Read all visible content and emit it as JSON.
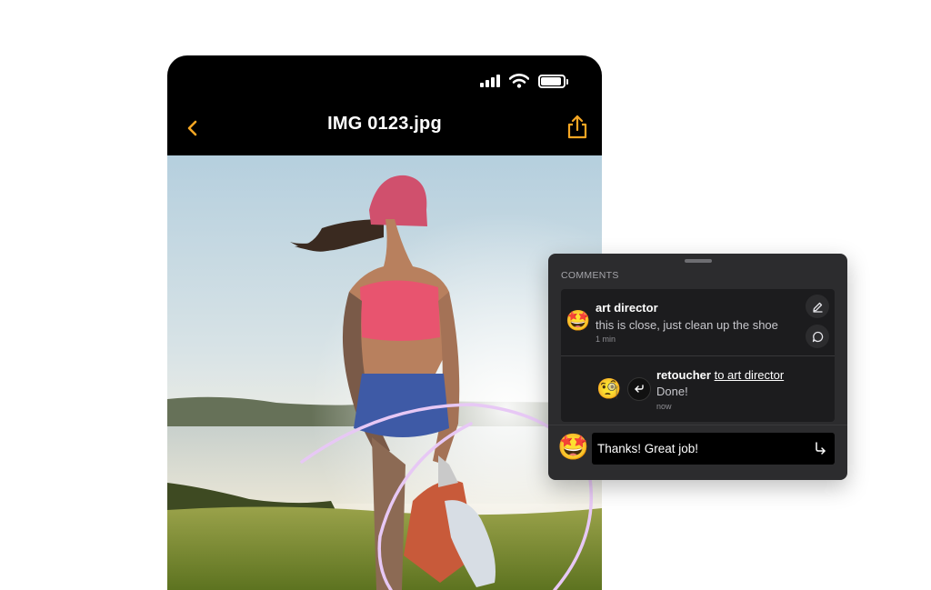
{
  "phone": {
    "status": {
      "signal_icon": "cellular-signal-icon",
      "wifi_icon": "wifi-icon",
      "battery_icon": "battery-icon",
      "battery_level": 0.9
    },
    "nav": {
      "title": "IMG 0123.jpg",
      "back_icon": "chevron-left-icon",
      "share_icon": "share-icon",
      "accent": "#f5a623"
    },
    "photo": {
      "subject": "athlete-stretching-photo"
    }
  },
  "comments": {
    "header": "COMMENTS",
    "thread": [
      {
        "author": "art director",
        "avatar_icon": "star-struck-emoji-icon",
        "text": "this is close, just clean up the shoe",
        "time": "1 min"
      },
      {
        "author": "retoucher",
        "mention": "to art director",
        "avatar_icon": "monocle-face-emoji-icon",
        "text": "Done!",
        "time": "now"
      }
    ],
    "actions": {
      "edit_icon": "edit-icon",
      "reply_icon": "reply-bubble-icon"
    },
    "composer": {
      "value": "Thanks! Great job!",
      "avatar_icon": "star-struck-emoji-icon",
      "send_icon": "send-arrow-icon"
    }
  },
  "colors": {
    "annotation_stroke": "#e7c8f5",
    "panel_bg": "#2c2c2e",
    "thread_bg": "#1c1c1e"
  }
}
